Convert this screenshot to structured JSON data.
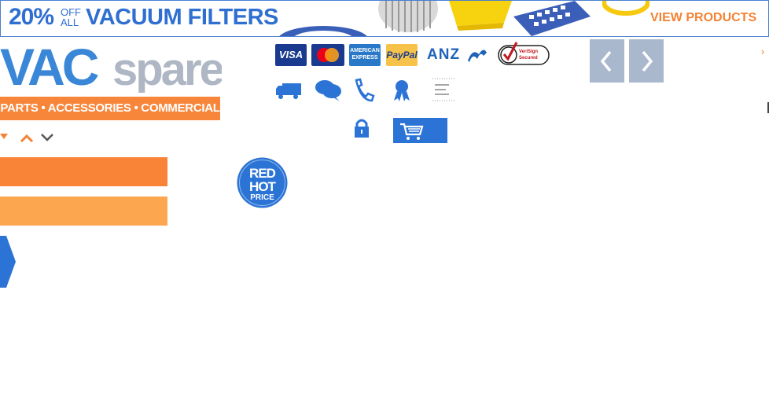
{
  "banner": {
    "percent": "20%",
    "off": "OFF",
    "all": "ALL",
    "title": "VACUUM FILTERS",
    "cta": "VIEW PRODUCTS"
  },
  "logo": {
    "word_vac": "VAC",
    "word_spare": "spare",
    "tagline": "PARTS • ACCESSORIES • COMMERCIAL"
  },
  "payments": {
    "visa": "VISA",
    "amex_top": "AMERICAN",
    "amex_bottom": "EXPRESS",
    "paypal": "PayPal",
    "anz": "ANZ",
    "verisign_top": "VeriSign",
    "verisign_bottom": "Secured"
  },
  "badge": {
    "line1": "RED",
    "line2": "HOT",
    "line3": "PRICE"
  },
  "colors": {
    "brand_blue": "#2f6fd1",
    "brand_orange": "#f58233",
    "cart_blue": "#2b74d6",
    "slider_grey": "#a9b8cd"
  },
  "icons": [
    "truck-icon",
    "chat-icon",
    "phone-icon",
    "award-ribbon-icon",
    "menu-lines-icon",
    "lock-icon",
    "cart-icon"
  ]
}
